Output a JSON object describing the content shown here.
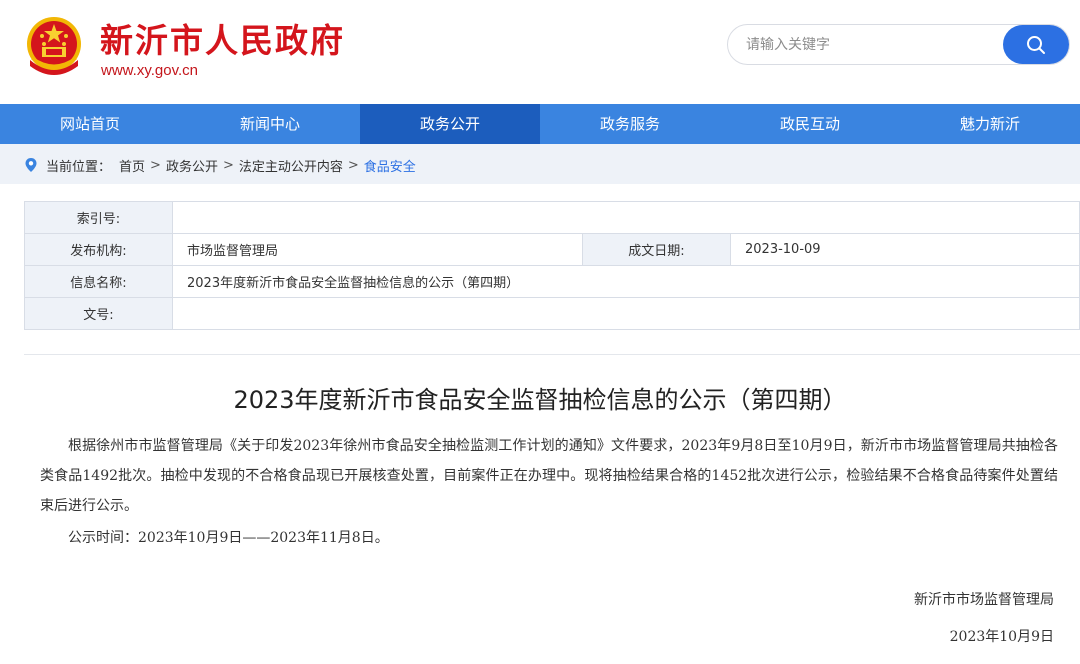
{
  "header": {
    "site_title": "新沂市人民政府",
    "site_url": "www.xy.gov.cn",
    "emblem_icon": "national-emblem-icon",
    "search": {
      "placeholder": "请输入关键字",
      "icon": "search-icon"
    }
  },
  "nav": {
    "items": [
      {
        "label": "网站首页",
        "active": false
      },
      {
        "label": "新闻中心",
        "active": false
      },
      {
        "label": "政务公开",
        "active": true
      },
      {
        "label": "政务服务",
        "active": false
      },
      {
        "label": "政民互动",
        "active": false
      },
      {
        "label": "魅力新沂",
        "active": false
      }
    ]
  },
  "breadcrumb": {
    "prefix": "当前位置：",
    "items": [
      "首页",
      "政务公开",
      "法定主动公开内容",
      "食品安全"
    ],
    "separator": ">"
  },
  "info": {
    "index_label": "索引号:",
    "index_value": "",
    "publisher_label": "发布机构:",
    "publisher_value": "市场监督管理局",
    "date_label": "成文日期:",
    "date_value": "2023-10-09",
    "name_label": "信息名称:",
    "name_value": "2023年度新沂市食品安全监督抽检信息的公示（第四期）",
    "doc_label": "文号:",
    "doc_value": ""
  },
  "article": {
    "title": "2023年度新沂市食品安全监督抽检信息的公示（第四期）",
    "para1": "根据徐州市市监督管理局《关于印发2023年徐州市食品安全抽检监测工作计划的通知》文件要求，2023年9月8日至10月9日，新沂市市场监督管理局共抽检各类食品1492批次。抽检中发现的不合格食品现已开展核查处置，目前案件正在办理中。现将抽检结果合格的1452批次进行公示，检验结果不合格食品待案件处置结束后进行公示。",
    "para2": "公示时间：2023年10月9日——2023年11月8日。",
    "signer": "新沂市市场监督管理局",
    "sign_date": "2023年10月9日"
  },
  "colors": {
    "brand_red": "#d4151c",
    "nav_blue": "#3a84e0",
    "nav_active": "#1c5dbd",
    "accent_blue": "#2c70e3"
  }
}
